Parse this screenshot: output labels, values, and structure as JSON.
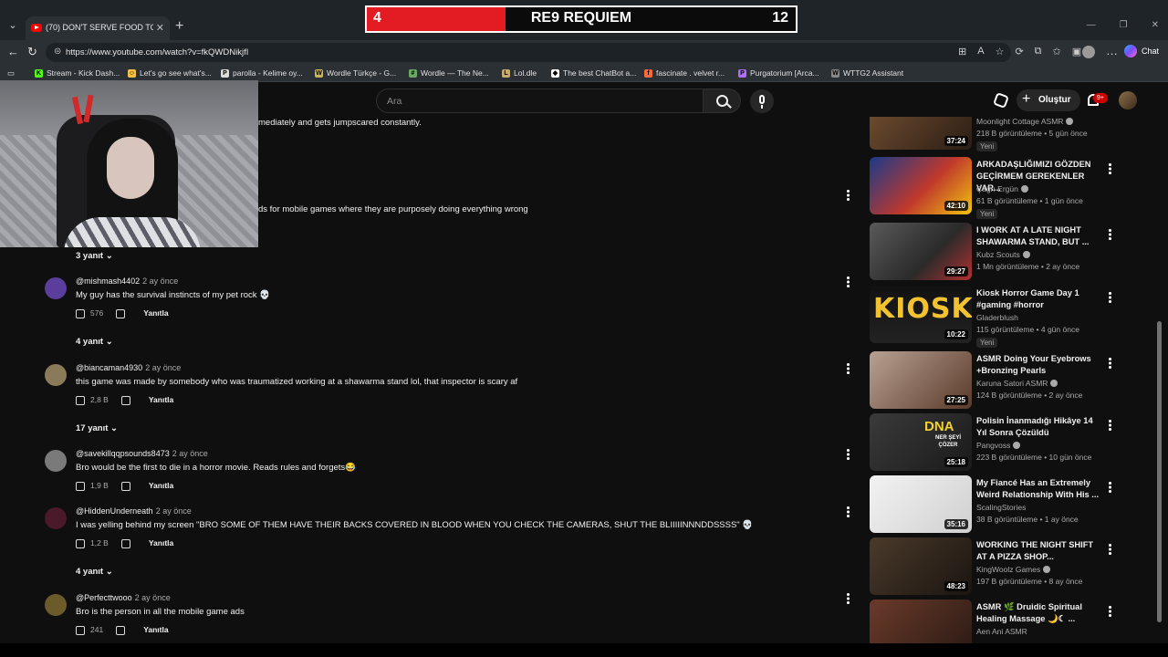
{
  "browser": {
    "tab_title": "(70) DON'T SERVE FOOD TO THE S",
    "url": "https://www.youtube.com/watch?v=fkQWDNikjfI",
    "chat_label": "Chat",
    "bookmarks": [
      {
        "label": "Stream - Kick Dash...",
        "icon_color": "#53fc18",
        "icon_char": "K"
      },
      {
        "label": "Let's go see what's...",
        "icon_color": "#f7c244",
        "icon_char": "☺"
      },
      {
        "label": "parolla - Kelime oy...",
        "icon_color": "#dddddd",
        "icon_char": "P"
      },
      {
        "label": "Wordle Türkçe - G...",
        "icon_color": "#c9b458",
        "icon_char": "W"
      },
      {
        "label": "Wordle — The Ne...",
        "icon_color": "#6aaa64",
        "icon_char": "#"
      },
      {
        "label": "Lol.dle",
        "icon_color": "#c8aa6e",
        "icon_char": "L"
      },
      {
        "label": "The best ChatBot a...",
        "icon_color": "#ffffff",
        "icon_char": "◆"
      },
      {
        "label": "fascinate . velvet r...",
        "icon_color": "#ff6a3d",
        "icon_char": "f"
      },
      {
        "label": "Purgatorium [Arca...",
        "icon_color": "#b36bff",
        "icon_char": "P"
      },
      {
        "label": "WTTG2 Assistant",
        "icon_color": "#888888",
        "icon_char": "W"
      }
    ]
  },
  "scoreboard": {
    "left_score": "4",
    "title": "RE9 REQUIEM",
    "right_score": "12"
  },
  "yt_header": {
    "search_placeholder": "Ara",
    "create_label": "Oluştur",
    "notif_count": "9+"
  },
  "comments": {
    "partial_text_1": "mediately and gets jumpscared constantly.",
    "partial_text_2": "ds for mobile games where they are purposely doing everything wrong",
    "reply_label": "Yanıtla",
    "first_replies": "3 yanıt",
    "items": [
      {
        "author": "@mishmash4402",
        "time": "2 ay önce",
        "text": "My guy has the survival instincts of my pet rock 💀",
        "likes": "576",
        "replies": "4 yanıt",
        "avatar_color": "#5b3d9c"
      },
      {
        "author": "@biancaman4930",
        "time": "2 ay önce",
        "text": "this game was made by somebody who was traumatized working at a shawarma stand lol, that inspector is scary af",
        "likes": "2,8 B",
        "replies": "17 yanıt",
        "avatar_color": "#8a7a5a"
      },
      {
        "author": "@savekillqqpsounds8473",
        "time": "2 ay önce",
        "text": "Bro would be the first to die in a horror movie. Reads rules and forgets😂",
        "likes": "1,9 B",
        "replies": "",
        "avatar_color": "#7a7a7a"
      },
      {
        "author": "@HiddenUnderneath",
        "time": "2 ay önce",
        "text": "I was yelling behind my screen \"BRO SOME OF THEM HAVE THEIR BACKS COVERED IN BLOOD WHEN YOU CHECK THE CAMERAS, SHUT THE BLIIIIINNNDDSSSS\" 💀",
        "likes": "1,2 B",
        "replies": "4 yanıt",
        "avatar_color": "#4a1a2a"
      },
      {
        "author": "@Perfecttwooo",
        "time": "2 ay önce",
        "text": "Bro is the person in all the mobile game ads",
        "likes": "241",
        "replies": "",
        "avatar_color": "#6b5a2a"
      }
    ]
  },
  "sidebar": {
    "items": [
      {
        "title": "",
        "channel": "Moonlight Cottage ASMR",
        "verified": true,
        "meta": "218 B görüntüleme • 5 gün önce",
        "badge": "Yeni",
        "duration": "37:24",
        "thumb": "linear-gradient(135deg,#6b4a2e,#2a1d14)"
      },
      {
        "title": "ARKADAŞLIĞIMIZI GÖZDEN GEÇİRMEM GEREKENLER VAR...",
        "channel": "Çağrı Ergün",
        "verified": true,
        "meta": "61 B görüntüleme • 1 gün önce",
        "badge": "Yeni",
        "duration": "42:10",
        "thumb": "linear-gradient(135deg,#1a3a8a,#c0392b 55%,#f1c40f)"
      },
      {
        "title": "I WORK AT A LATE NIGHT SHAWARMA STAND, BUT ...",
        "channel": "Kubz Scouts",
        "verified": true,
        "meta": "1 Mn görüntüleme • 2 ay önce",
        "badge": "",
        "duration": "29:27",
        "thumb": "linear-gradient(135deg,#5a5a5a,#2a2a2a 60%,#b03030)"
      },
      {
        "title": "Kiosk Horror Game Day 1 #gaming #horror",
        "channel": "Gladerblush",
        "verified": false,
        "meta": "115 görüntüleme • 4 gün önce",
        "badge": "Yeni",
        "duration": "10:22",
        "thumb": "linear-gradient(180deg,#111,#222)"
      },
      {
        "title": "ASMR Doing Your Eyebrows +Bronzing Pearls",
        "channel": "Karuna Satori ASMR",
        "verified": true,
        "meta": "124 B görüntüleme • 2 ay önce",
        "badge": "",
        "duration": "27:25",
        "thumb": "linear-gradient(135deg,#b8a192,#5a3a2a)"
      },
      {
        "title": "Polisin İnanmadığı Hikâye 14 Yıl Sonra Çözüldü",
        "channel": "Pangvoss",
        "verified": true,
        "meta": "223 B görüntüleme • 10 gün önce",
        "badge": "",
        "duration": "25:18",
        "thumb": "linear-gradient(135deg,#3a3a3a,#1a1a1a)"
      },
      {
        "title": "My Fiancé Has an Extremely Weird Relationship With His ...",
        "channel": "ScalingStories",
        "verified": false,
        "meta": "38 B görüntüleme • 1 ay önce",
        "badge": "",
        "duration": "35:16",
        "thumb": "linear-gradient(135deg,#f2f2f2,#d0d0d0)"
      },
      {
        "title": "WORKING THE NIGHT SHIFT AT A PIZZA SHOP...",
        "channel": "KingWoolz Games",
        "verified": true,
        "meta": "197 B görüntüleme • 8 ay önce",
        "badge": "",
        "duration": "48:23",
        "thumb": "linear-gradient(135deg,#4a3a2a,#1a1410)"
      },
      {
        "title": "ASMR 🌿 Druidic Spiritual Healing Massage 🌙☾ ...",
        "channel": "Aen Ani ASMR",
        "verified": false,
        "meta": "",
        "badge": "",
        "duration": "",
        "thumb": "linear-gradient(135deg,#6a3a2a,#2a1a14)"
      }
    ],
    "kiosk_text": "KIOSK",
    "dna_text": "DNA",
    "dna_sub": "NER ŞEYİ ÇÖZER"
  }
}
